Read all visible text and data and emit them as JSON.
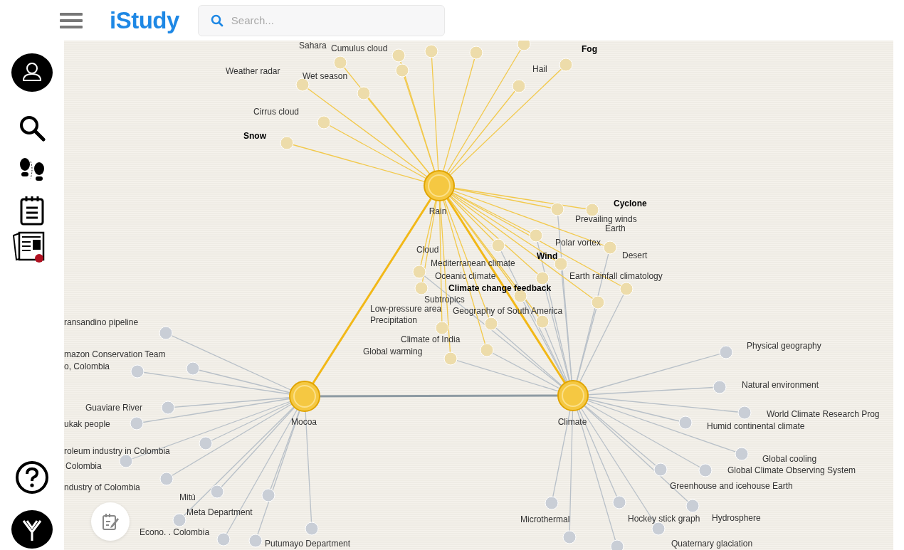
{
  "header": {
    "logo": "iStudy",
    "search": {
      "placeholder": "Search..."
    }
  },
  "graph": {
    "hubs": [
      {
        "label": "Rain"
      },
      {
        "label": "Mocoa"
      },
      {
        "label": "Climate"
      }
    ],
    "nodes": [
      {
        "label": "Sahara",
        "bold": false
      },
      {
        "label": "Cumulus cloud",
        "bold": false
      },
      {
        "label": "Weather radar",
        "bold": false
      },
      {
        "label": "Wet season",
        "bold": false
      },
      {
        "label": "Cirrus cloud",
        "bold": false
      },
      {
        "label": "Snow",
        "bold": true
      },
      {
        "label": "Fog",
        "bold": true
      },
      {
        "label": "Hail",
        "bold": false
      },
      {
        "label": "Cyclone",
        "bold": true
      },
      {
        "label": "Prevailing winds",
        "bold": false
      },
      {
        "label": "Earth",
        "bold": false
      },
      {
        "label": "Polar vortex",
        "bold": false
      },
      {
        "label": "Desert",
        "bold": false
      },
      {
        "label": "Wind",
        "bold": true
      },
      {
        "label": "Cloud",
        "bold": false
      },
      {
        "label": "Mediterranean climate",
        "bold": false
      },
      {
        "label": "Oceanic climate",
        "bold": false
      },
      {
        "label": "Climate change feedback",
        "bold": true
      },
      {
        "label": "Subtropics",
        "bold": false
      },
      {
        "label": "Earth rainfall climatology",
        "bold": false
      },
      {
        "label": "Low-pressure area",
        "bold": false
      },
      {
        "label": "Geography of South America",
        "bold": false
      },
      {
        "label": "Precipitation",
        "bold": false
      },
      {
        "label": "Climate of India",
        "bold": false
      },
      {
        "label": "Global warming",
        "bold": false
      },
      {
        "label": "ransandino pipeline",
        "bold": false
      },
      {
        "label": "mazon Conservation Team",
        "bold": false
      },
      {
        "label": "o, Colombia",
        "bold": false
      },
      {
        "label": "Guaviare River",
        "bold": false
      },
      {
        "label": "ukak people",
        "bold": false
      },
      {
        "label": "roleum industry in Colombia",
        "bold": false
      },
      {
        "label": "Colombia",
        "bold": false
      },
      {
        "label": "ndustry of Colombia",
        "bold": false
      },
      {
        "label": "Mitú",
        "bold": false
      },
      {
        "label": "Meta Department",
        "bold": false
      },
      {
        "label": "Econo.  . Colombia",
        "bold": false
      },
      {
        "label": "Putumayo Department",
        "bold": false
      },
      {
        "label": "Physical geography",
        "bold": false
      },
      {
        "label": "Natural environment",
        "bold": false
      },
      {
        "label": "World Climate Research Prog",
        "bold": false
      },
      {
        "label": "Humid continental climate",
        "bold": false
      },
      {
        "label": "Global cooling",
        "bold": false
      },
      {
        "label": "Global Climate Observing System",
        "bold": false
      },
      {
        "label": "Greenhouse and icehouse Earth",
        "bold": false
      },
      {
        "label": "Microthermal",
        "bold": false
      },
      {
        "label": "Hockey stick graph",
        "bold": false
      },
      {
        "label": "Hydrosphere",
        "bold": false
      },
      {
        "label": "Quaternary glaciation",
        "bold": false
      }
    ]
  }
}
